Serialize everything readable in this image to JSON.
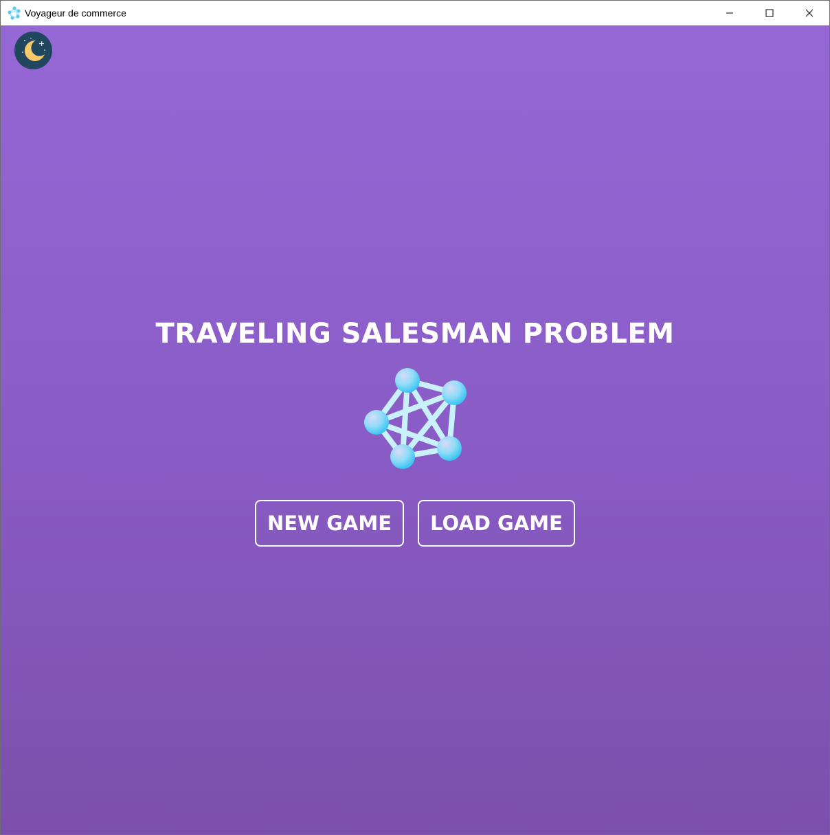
{
  "window": {
    "title": "Voyageur de commerce",
    "controls": [
      "minimize-icon",
      "maximize-icon",
      "close-icon"
    ]
  },
  "colors": {
    "background_top": "#9568d6",
    "background_bottom": "#7b50ab",
    "toggle_bg": "#21475f",
    "moon": "#f7c96b",
    "node": "#6fd3f5",
    "edge": "#c8f1fb",
    "text": "#ffffff"
  },
  "theme_toggle": {
    "icon": "moon-icon"
  },
  "main": {
    "title": "TRAVELING SALESMAN PROBLEM",
    "logo_icon": "network-graph-icon",
    "new_game_label": "NEW GAME",
    "load_game_label": "LOAD GAME"
  }
}
